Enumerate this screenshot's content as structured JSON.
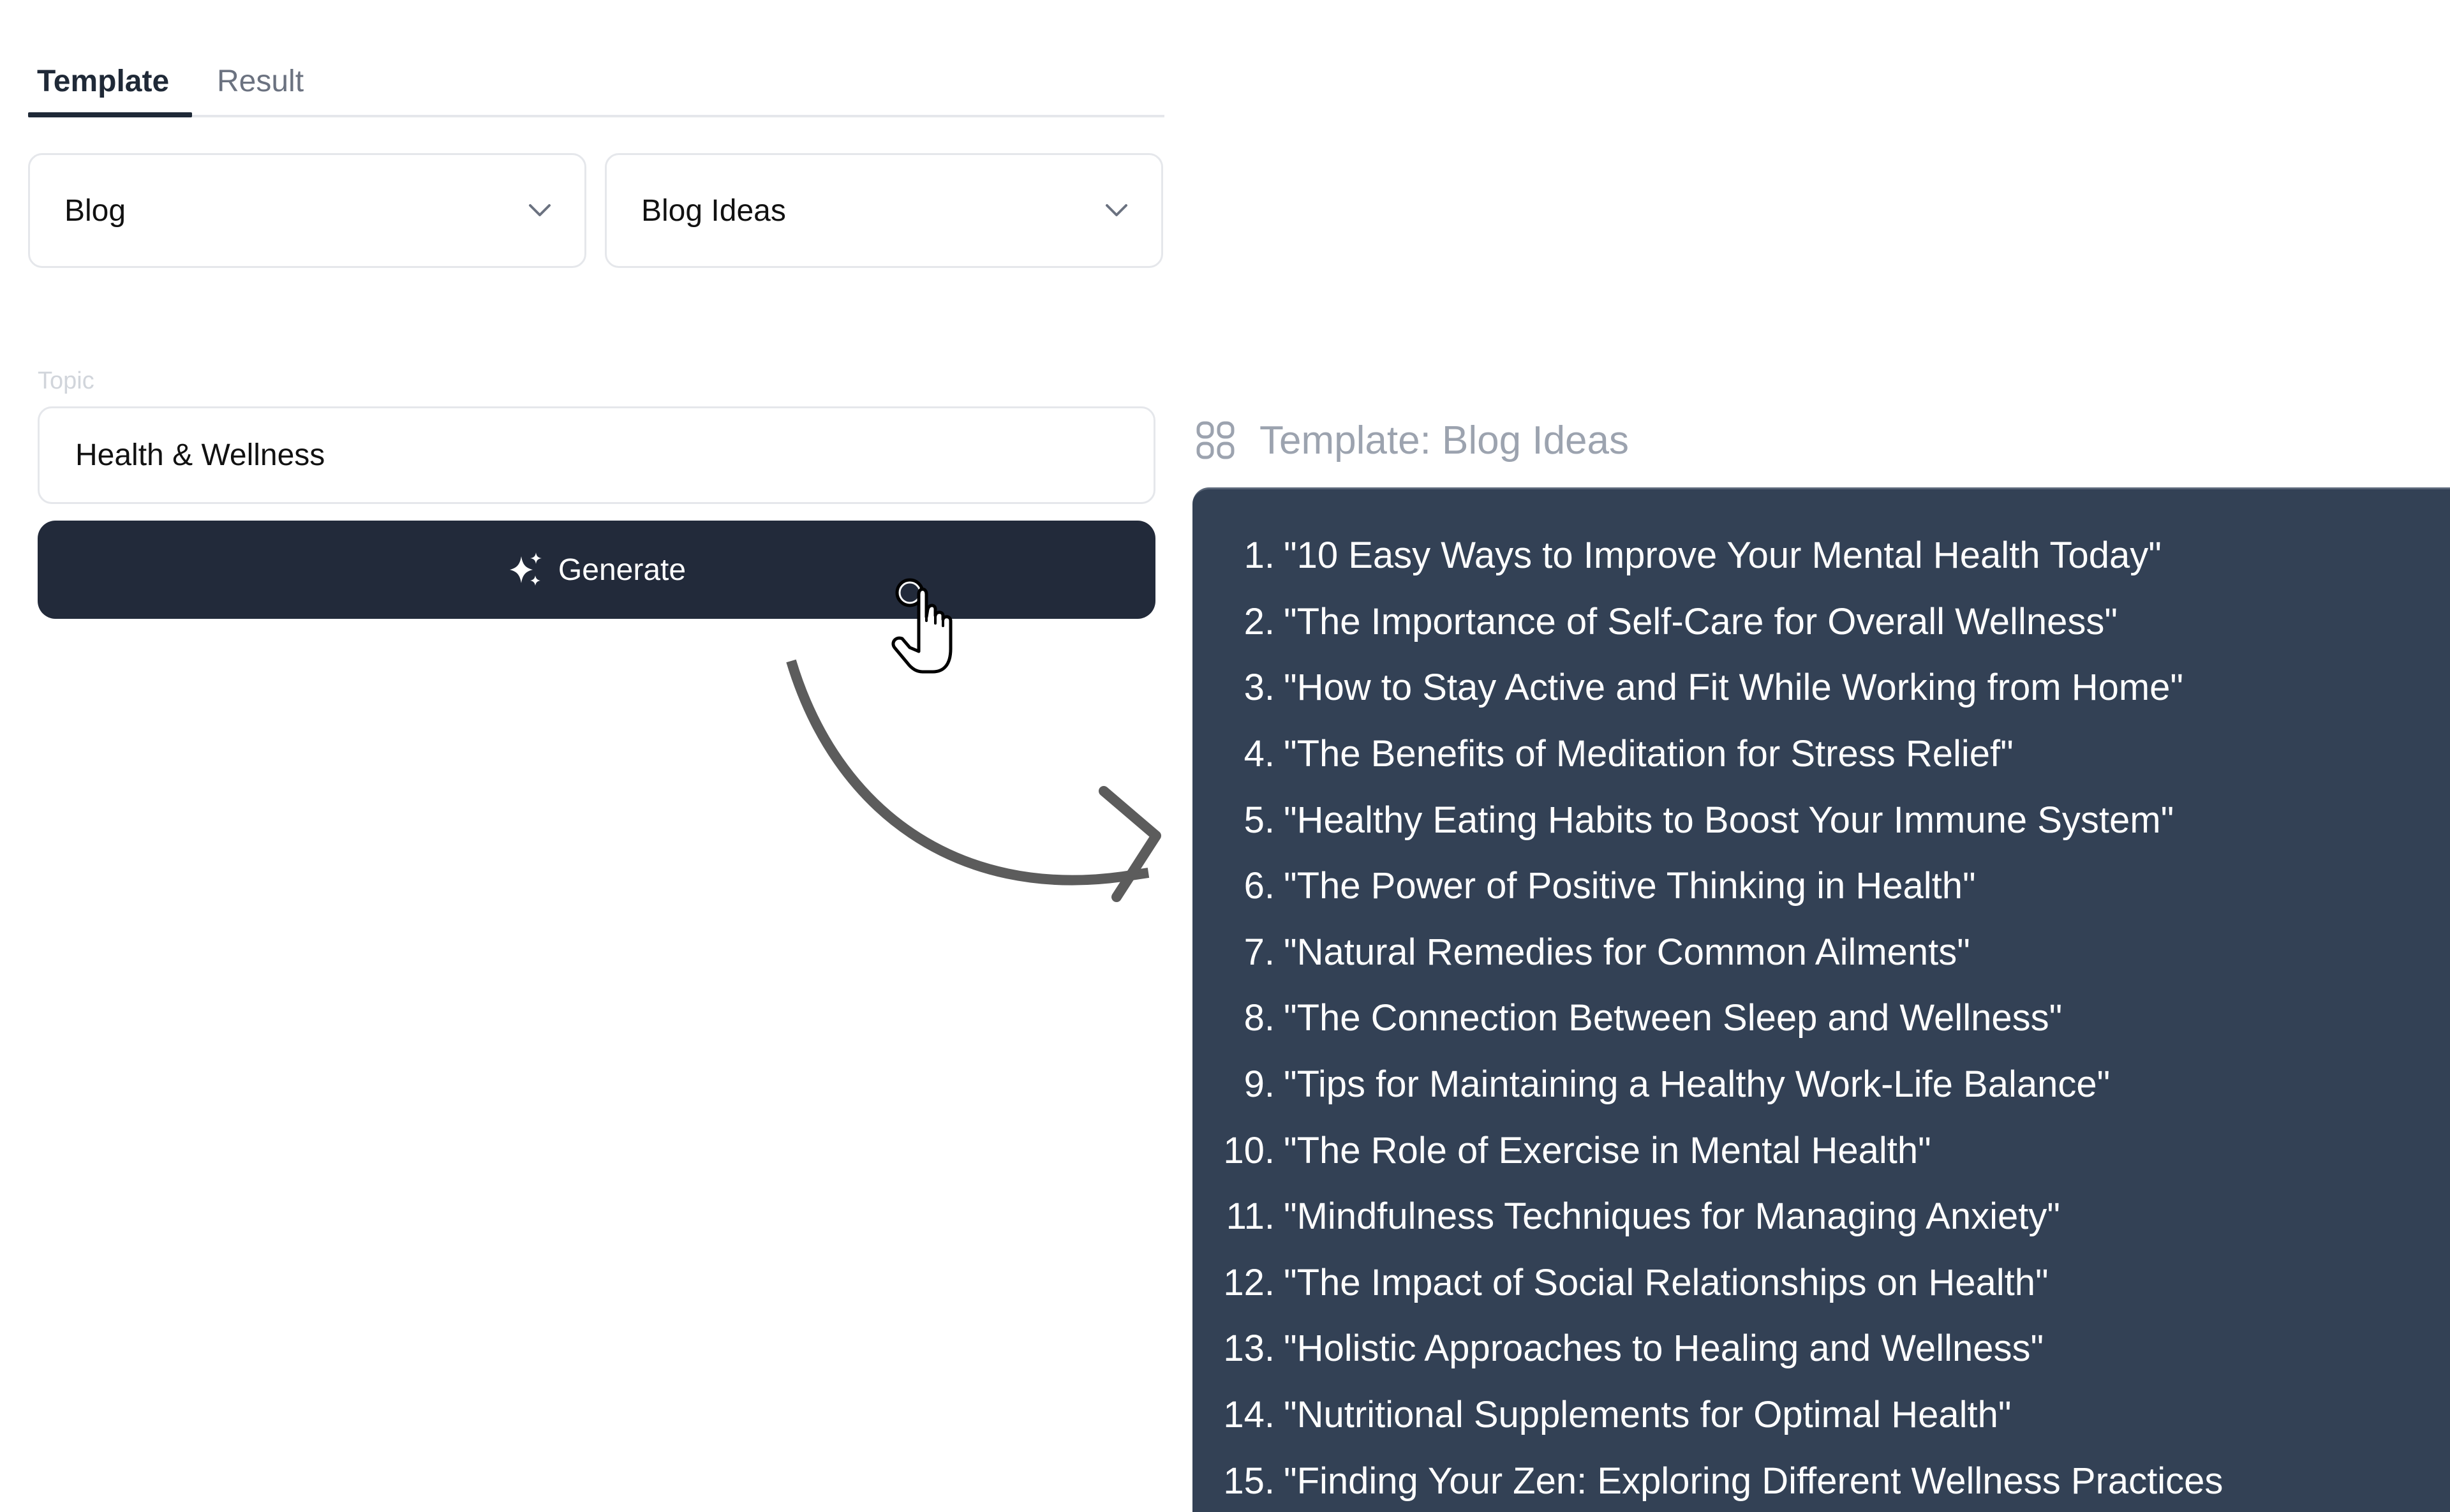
{
  "tabs": [
    {
      "label": "Template",
      "active": true
    },
    {
      "label": "Result",
      "active": false
    }
  ],
  "selects": {
    "category": {
      "value": "Blog",
      "icon": "chevron-down-icon"
    },
    "template": {
      "value": "Blog Ideas",
      "icon": "chevron-down-icon"
    }
  },
  "topic": {
    "label": "Topic",
    "value": "Health & Wellness"
  },
  "generate_button": {
    "label": "Generate",
    "icon": "sparkles-icon"
  },
  "result": {
    "header_icon": "grid-icon",
    "title": "Template: Blog Ideas",
    "items": [
      {
        "num": "1.",
        "text": "\"10 Easy Ways to Improve Your Mental Health Today\""
      },
      {
        "num": "2.",
        "text": "\"The Importance of Self-Care for Overall Wellness\""
      },
      {
        "num": "3.",
        "text": "\"How to Stay Active and Fit While Working from Home\""
      },
      {
        "num": "4.",
        "text": "\"The Benefits of Meditation for Stress Relief\""
      },
      {
        "num": "5.",
        "text": "\"Healthy Eating Habits to Boost Your Immune System\""
      },
      {
        "num": "6.",
        "text": "\"The Power of Positive Thinking in Health\""
      },
      {
        "num": "7.",
        "text": "\"Natural Remedies for Common Ailments\""
      },
      {
        "num": "8.",
        "text": "\"The Connection Between Sleep and Wellness\""
      },
      {
        "num": "9.",
        "text": "\"Tips for Maintaining a Healthy Work-Life Balance\""
      },
      {
        "num": "10.",
        "text": "\"The Role of Exercise in Mental Health\""
      },
      {
        "num": "11.",
        "text": "\"Mindfulness Techniques for Managing Anxiety\""
      },
      {
        "num": "12.",
        "text": "\"The Impact of Social Relationships on Health\""
      },
      {
        "num": "13.",
        "text": "\"Holistic Approaches to Healing and Wellness\""
      },
      {
        "num": "14.",
        "text": "\"Nutritional Supplements for Optimal Health\""
      },
      {
        "num": "15.",
        "text": "\"Finding Your Zen: Exploring Different Wellness Practices"
      }
    ]
  },
  "colors": {
    "primary_dark": "#222a3a",
    "panel_bg": "#334155",
    "tab_active": "#1f2937",
    "tab_inactive": "#6b7280",
    "muted_text": "#9ca3af",
    "border": "#e5e7eb",
    "arrow": "#5c5c5c"
  }
}
